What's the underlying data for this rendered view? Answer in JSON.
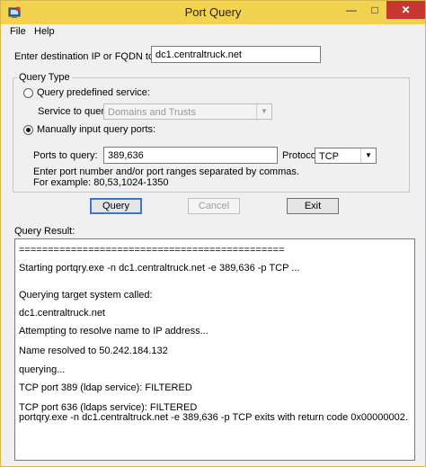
{
  "window": {
    "title": "Port Query"
  },
  "titlebar": {
    "minimize": "—",
    "maximize": "□",
    "close": "✕"
  },
  "menu": [
    "File",
    "Help"
  ],
  "destination": {
    "label": "Enter destination IP or FQDN to query:",
    "value": "dc1.centraltruck.net"
  },
  "query_type": {
    "title": "Query Type",
    "predefined_label": "Query predefined service:",
    "service_label": "Service to query:",
    "service_value": "Domains and Trusts",
    "manual_label": "Manually input query ports:",
    "ports_label": "Ports to query:",
    "ports_value": "389,636",
    "protocol_label": "Protocol:",
    "protocol_value": "TCP",
    "hint_1": "Enter port number and/or port ranges separated by commas.",
    "hint_2": "For example: 80,53,1024-1350",
    "selected": "manual"
  },
  "buttons": {
    "query": "Query",
    "cancel": "Cancel",
    "exit": "Exit"
  },
  "result": {
    "label": "Query Result:",
    "lines": [
      "==============================================",
      "Starting portqry.exe -n dc1.centraltruck.net -e 389,636 -p TCP ...",
      "Querying target system called:",
      "dc1.centraltruck.net",
      "Attempting to resolve name to IP address...",
      "Name resolved to 50.242.184.132",
      "querying...",
      "TCP port 389 (ldap service): FILTERED",
      "TCP port 636 (ldaps service): FILTERED",
      "portqry.exe -n dc1.centraltruck.net -e 389,636 -p TCP exits with return code 0x00000002."
    ]
  }
}
